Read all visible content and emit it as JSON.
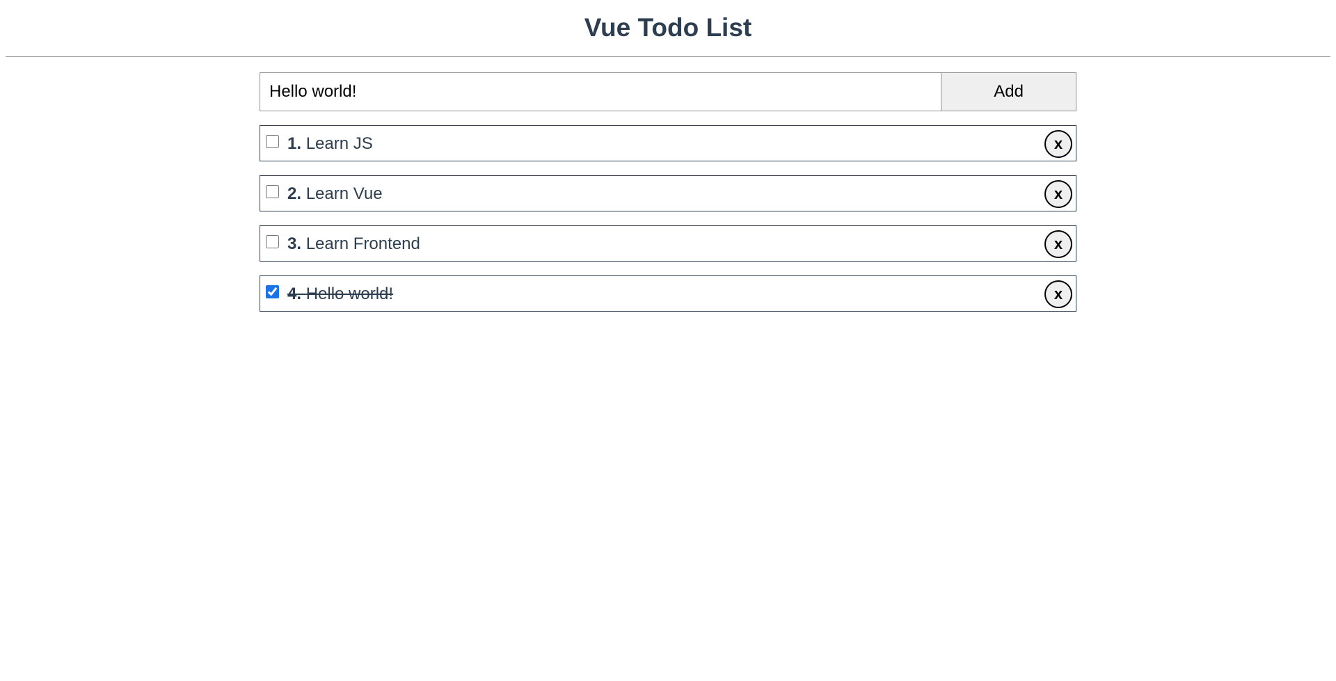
{
  "header": {
    "title": "Vue Todo List"
  },
  "form": {
    "input_value": "Hello world!",
    "add_label": "Add"
  },
  "todos": [
    {
      "number": "1.",
      "text": "Learn JS",
      "done": false,
      "delete_label": "x"
    },
    {
      "number": "2.",
      "text": "Learn Vue",
      "done": false,
      "delete_label": "x"
    },
    {
      "number": "3.",
      "text": "Learn Frontend",
      "done": false,
      "delete_label": "x"
    },
    {
      "number": "4.",
      "text": "Hello world!",
      "done": true,
      "delete_label": "x"
    }
  ],
  "colors": {
    "text": "#2c3e50",
    "checkbox_accent": "#1a73e8",
    "button_bg": "#efefef"
  }
}
